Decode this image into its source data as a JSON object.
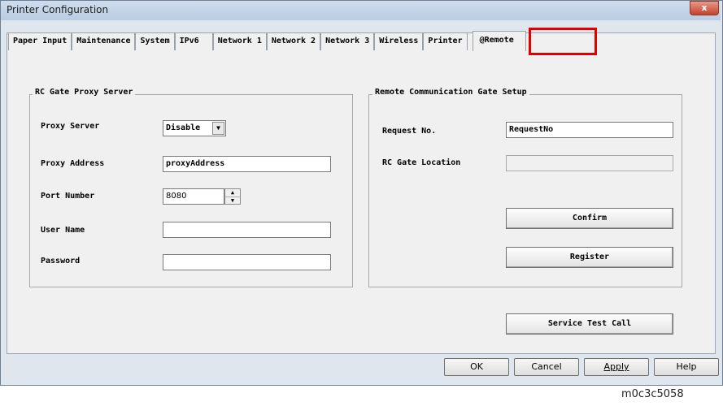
{
  "window": {
    "title": "Printer Configuration",
    "close_glyph": "x"
  },
  "tabs": [
    {
      "label": "Paper Input"
    },
    {
      "label": "Maintenance"
    },
    {
      "label": "System"
    },
    {
      "label": "IPv6"
    },
    {
      "label": "Network 1"
    },
    {
      "label": "Network 2"
    },
    {
      "label": "Network 3"
    },
    {
      "label": "Wireless"
    },
    {
      "label": "Printer"
    },
    {
      "label": "@Remote"
    }
  ],
  "proxy_group": {
    "legend": "RC Gate Proxy Server",
    "proxy_server_label": "Proxy Server",
    "proxy_server_value": "Disable",
    "proxy_address_label": "Proxy Address",
    "proxy_address_value": "proxyAddress",
    "port_label": "Port Number",
    "port_value": "8080",
    "user_label": "User Name",
    "user_value": "",
    "password_label": "Password",
    "password_value": ""
  },
  "gate_group": {
    "legend": "Remote Communication Gate Setup",
    "request_label": "Request No.",
    "request_value": "RequestNo",
    "location_label": "RC Gate Location",
    "location_value": "",
    "confirm_label": "Confirm",
    "register_label": "Register"
  },
  "service_test_label": "Service Test Call",
  "footer": {
    "ok": "OK",
    "cancel": "Cancel",
    "apply": "Apply",
    "help": "Help"
  },
  "caption": "m0c3c5058",
  "colors": {
    "highlight": "#e10000",
    "close": "#c8412b"
  }
}
